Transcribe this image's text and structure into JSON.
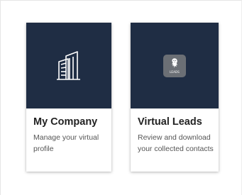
{
  "cards": [
    {
      "title": "My Company",
      "description": "Manage your virtual profile",
      "icon": "building-icon",
      "media_color": "#1f2d44"
    },
    {
      "title": "Virtual Leads",
      "description": "Review and download your collected contacts",
      "icon": "leads-logo-icon",
      "logo_text": "LEADS",
      "media_color": "#1f2d44"
    }
  ]
}
